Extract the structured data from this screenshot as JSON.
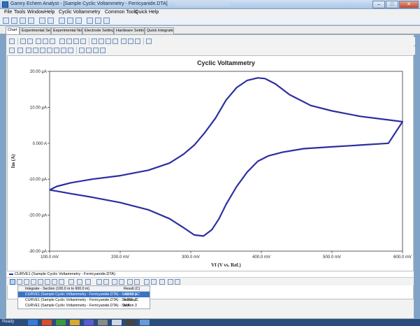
{
  "window": {
    "title": "Gamry Echem Analyst - [Sample Cyclic Voltammetry - Ferricyanide.DTA]",
    "buttons": [
      "–",
      "□",
      "✕"
    ]
  },
  "menu": {
    "items": [
      "File",
      "Tools",
      "Window",
      "Help",
      "Cyclic Voltammetry",
      "Common Tools",
      "Quick Help"
    ]
  },
  "tabs": [
    "Chart",
    "Experimental Setup",
    "Experimental Notes",
    "Electrode Settings",
    "Hardware Settings",
    "Quick Integration"
  ],
  "chart_data": {
    "type": "line",
    "title": "Cyclic Voltammetry",
    "xlabel": "Vf (V vs. Ref.)",
    "ylabel": "Im (A)",
    "xlim": [
      100,
      600
    ],
    "ylim": [
      -30,
      20
    ],
    "x_ticks": [
      "100.0 mV",
      "200.0 mV",
      "300.0 mV",
      "400.0 mV",
      "500.0 mV",
      "600.0 mV"
    ],
    "y_ticks": [
      "20.00 µA",
      "10.00 µA",
      "0.000 A",
      "-10.00 µA",
      "-20.00 µA",
      "-30.00 µA"
    ],
    "x_tick_values": [
      100,
      200,
      300,
      400,
      500,
      600
    ],
    "y_tick_values": [
      20,
      10,
      0,
      -10,
      -20,
      -30
    ],
    "x_units": "mV",
    "y_units": "µA",
    "grid": false,
    "series": [
      {
        "name": "CURVE1 (Sample Cyclic Voltammetry - Ferricyanide.DTA)",
        "color": "#2b2fa0",
        "x": [
          100,
          110,
          130,
          160,
          200,
          240,
          270,
          290,
          305,
          320,
          335,
          350,
          365,
          380,
          395,
          405,
          420,
          440,
          470,
          500,
          540,
          580,
          600,
          580,
          540,
          500,
          460,
          430,
          410,
          395,
          380,
          365,
          350,
          340,
          330,
          318,
          305,
          290,
          270,
          240,
          200,
          160,
          130,
          110,
          100
        ],
        "y": [
          -13,
          -12,
          -11,
          -10,
          -9,
          -7.5,
          -5.5,
          -3,
          -0.5,
          3,
          7,
          12,
          15.5,
          17.5,
          18.2,
          18,
          16.5,
          13.5,
          10.5,
          9,
          7.5,
          6.5,
          6,
          0,
          -0.5,
          -1,
          -1.5,
          -2.5,
          -3.5,
          -5,
          -8,
          -12,
          -17,
          -21,
          -24,
          -25.8,
          -25.5,
          -23.5,
          -21,
          -18.5,
          -16.5,
          -15,
          -14,
          -13.3,
          -13
        ]
      }
    ]
  },
  "legend": {
    "label": "CURVE1 (Sample Cyclic Voltammetry - Ferricyanide.DTA)"
  },
  "results": {
    "header": "Integrate - Section (100.0 m to 600.0 m)",
    "header_result": "Result (C)",
    "rows": [
      {
        "label": "CURVE1 (Sample Cyclic Voltammetry - Ferricyanide.DTA) - Section 1",
        "value": "-59.50 µC",
        "selected": true
      },
      {
        "label": "CURVE1 (Sample Cyclic Voltammetry - Ferricyanide.DTA) - Section 2",
        "value": "9.661 µC",
        "selected": false
      },
      {
        "label": "CURVE1 (Sample Cyclic Voltammetry - Ferricyanide.DTA) - Section 3",
        "value": "N/A",
        "selected": false
      }
    ]
  },
  "status": {
    "text": "Ready"
  },
  "colors": {
    "curve": "#2b2fa0",
    "selection": "#3b74c6",
    "taskbar": "#2a4d7a"
  }
}
